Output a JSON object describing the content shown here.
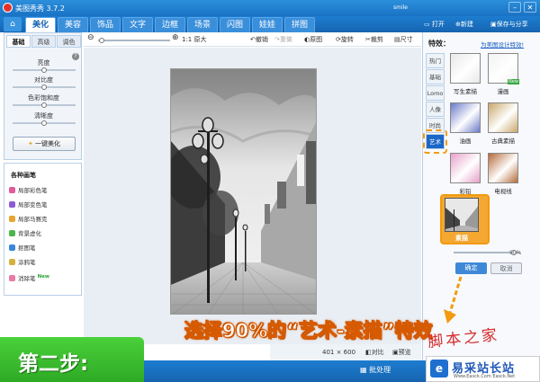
{
  "window": {
    "title": "美图秀秀 3.7.2",
    "user": "smile",
    "minimize_glyph": "–",
    "close_glyph": "✕"
  },
  "nav": {
    "home_icon": "home-icon",
    "tabs": [
      "美化",
      "美容",
      "饰品",
      "文字",
      "边框",
      "场景",
      "闪图",
      "娃娃",
      "拼图"
    ],
    "active_tab": "美化",
    "open": "打开",
    "new": "新建",
    "save_share": "保存与分享"
  },
  "adjust": {
    "tabs": [
      "基础",
      "高级",
      "调色"
    ],
    "active_tab": "基础",
    "sliders": [
      {
        "label": "亮度",
        "level": 0.5
      },
      {
        "label": "对比度",
        "level": 0.5
      },
      {
        "label": "色彩饱和度",
        "level": 0.5
      },
      {
        "label": "清晰度",
        "level": 0.5
      }
    ],
    "one_click": "一键美化",
    "help_glyph": "?"
  },
  "pens": {
    "title": "各种画笔",
    "items": [
      {
        "label": "局部彩色笔",
        "new": false,
        "color": "#e35a9a"
      },
      {
        "label": "局部变色笔",
        "new": false,
        "color": "#8a5ad8"
      },
      {
        "label": "局部马赛克",
        "new": false,
        "color": "#e6a530"
      },
      {
        "label": "背景虚化",
        "new": false,
        "color": "#4db64a"
      },
      {
        "label": "抠图笔",
        "new": false,
        "color": "#3a86d8"
      },
      {
        "label": "涂鸦笔",
        "new": false,
        "color": "#d8b13a"
      },
      {
        "label": "消除笔",
        "new": true,
        "color": "#e97aa6"
      }
    ],
    "new_badge": "New"
  },
  "toolbar": {
    "zoom_level": 0.05,
    "actual_size": "1:1 原大",
    "undo": "撤销",
    "redo": "重做",
    "original": "原图",
    "rotate": "旋转",
    "crop": "裁剪",
    "size": "尺寸"
  },
  "status": {
    "dimensions": "401 × 600",
    "compare": "对比",
    "preview": "预览"
  },
  "bottom": {
    "batch": "批处理"
  },
  "effects": {
    "title": "特效：",
    "link": "为美图设计特效!",
    "categories": [
      "热门",
      "基础",
      "Lomo",
      "人像",
      "时尚",
      "艺术"
    ],
    "active_category": "艺术",
    "thumbs": [
      {
        "label": "写生素描",
        "new": false,
        "tone": "#e8e8e8"
      },
      {
        "label": "漫画",
        "new": true,
        "tone": "#f2f2f2"
      },
      {
        "label": "油画",
        "new": false,
        "tone": "#6a7ac8"
      },
      {
        "label": "古典素描",
        "new": false,
        "tone": "#c9a86a"
      },
      {
        "label": "彩铅",
        "new": false,
        "tone": "#e6a0c8"
      },
      {
        "label": "电视线",
        "new": false,
        "tone": "#b56a3a"
      }
    ],
    "selected": "素描",
    "strength": "90%",
    "strength_level": 0.9,
    "ok": "确定",
    "cancel": "取消"
  },
  "overlay": {
    "instruction": "选择90%的“艺术-素描”特效",
    "step": "第二步:",
    "watermark": "脚本之家",
    "site_name": "易采站长站",
    "site_url": "Www.Easck.Com  Easck.Net",
    "site_mark": "e"
  }
}
